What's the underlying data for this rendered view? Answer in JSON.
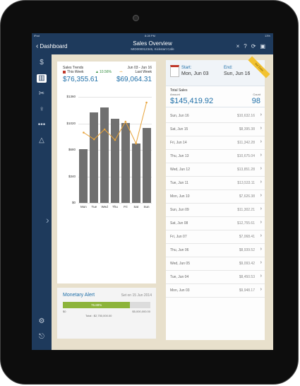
{
  "status": {
    "left": "iPad",
    "time": "8:28 PM",
    "right": "13%"
  },
  "nav": {
    "back_label": "Dashboard",
    "title": "Sales Overview",
    "subtitle": "MID000012345, Kickstart Cafe"
  },
  "trends": {
    "title": "Sales Trends",
    "range": "Jun 03 - Jun 16",
    "legend_this": "This Week",
    "legend_change": "10.56%",
    "legend_last": "Last Week",
    "this_total": "$76,355.61",
    "last_total": "$69,064.31"
  },
  "chart_data": {
    "type": "bar",
    "categories": [
      "Mon",
      "Tue",
      "Wed",
      "Thu",
      "Fri",
      "Sat",
      "Sun"
    ],
    "series": [
      {
        "name": "This Week",
        "values": [
          7627,
          12755,
          13533,
          11852,
          11342,
          8395,
          10632
        ]
      },
      {
        "name": "Last Week",
        "values": [
          9950,
          9000,
          10400,
          8900,
          11500,
          8400,
          14200
        ]
      }
    ],
    "ylim": [
      0,
      15000
    ],
    "y_ticks": [
      "$1360",
      "$1020",
      "$680",
      "$340",
      "$0"
    ],
    "colors": {
      "bars": "#707070",
      "line": "#e8a33a"
    }
  },
  "alert": {
    "title": "Monetary Alert",
    "set_on": "Set on 15 Jun 2014",
    "bar_label": "76.88%",
    "progress": 76.88,
    "min": "$0",
    "max": "$5,000,000.00",
    "total": "Total : $2,750,000.00"
  },
  "dates": {
    "start_label": "Start:",
    "start_value": "Mon, Jun 03",
    "end_label": "End:",
    "end_value": "Sun, Jun 16",
    "ribbon": "Set Date"
  },
  "totals": {
    "label": "Total Sales",
    "amount_label": "Amount",
    "amount": "$145,419.92",
    "count_label": "Count",
    "count": "98"
  },
  "daily": [
    {
      "date": "Sun, Jun 16",
      "value": "$10,632.16"
    },
    {
      "date": "Sat, Jun 15",
      "value": "$8,395.38"
    },
    {
      "date": "Fri, Jun 14",
      "value": "$11,342.28"
    },
    {
      "date": "Thu, Jun 13",
      "value": "$10,675.04"
    },
    {
      "date": "Wed, Jun 12",
      "value": "$13,851.28"
    },
    {
      "date": "Tue, Jun 11",
      "value": "$13,533.11"
    },
    {
      "date": "Mon, Jun 10",
      "value": "$7,626.38"
    },
    {
      "date": "Sun, Jun 09",
      "value": "$11,302.21"
    },
    {
      "date": "Sat, Jun 08",
      "value": "$12,755.61"
    },
    {
      "date": "Fri, Jun 07",
      "value": "$7,068.41"
    },
    {
      "date": "Thu, Jun 06",
      "value": "$8,939.52"
    },
    {
      "date": "Wed, Jun 05",
      "value": "$9,093.42"
    },
    {
      "date": "Tue, Jun 04",
      "value": "$8,450.53"
    },
    {
      "date": "Mon, Jun 03",
      "value": "$9,948.17"
    }
  ]
}
